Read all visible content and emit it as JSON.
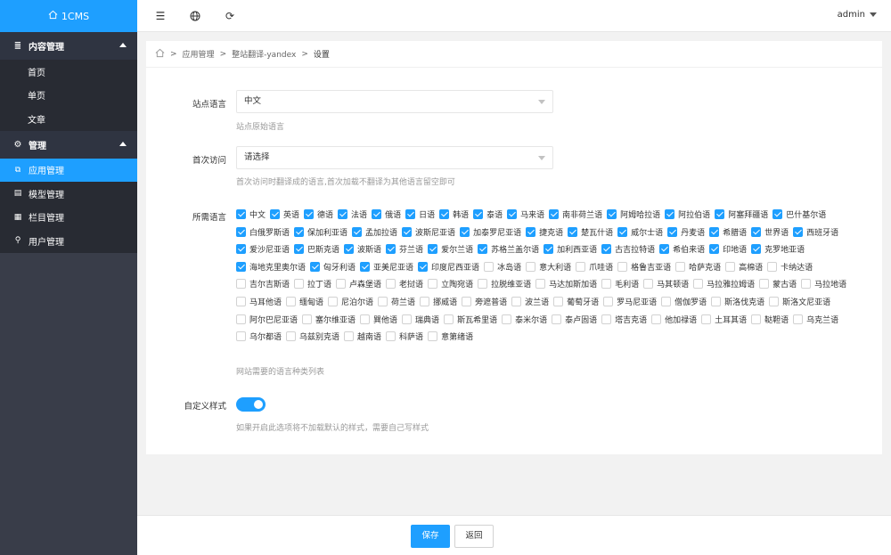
{
  "brand": {
    "icon": "home-icon",
    "name": "1CMS"
  },
  "sidebar": {
    "groups": [
      {
        "label": "内容管理",
        "icon": "list-icon",
        "items": [
          "首页",
          "单页",
          "文章"
        ]
      },
      {
        "label": "管理",
        "icon": "gear-icon",
        "items": [
          {
            "label": "应用管理",
            "icon": "app-icon"
          },
          {
            "label": "模型管理",
            "icon": "model-icon"
          },
          {
            "label": "栏目管理",
            "icon": "column-icon"
          },
          {
            "label": "用户管理",
            "icon": "user-icon"
          }
        ]
      }
    ]
  },
  "topbar": {
    "icons": [
      "menu-toggle-icon",
      "globe-icon",
      "refresh-icon"
    ],
    "user": "admin"
  },
  "breadcrumb": {
    "home_icon": "home-icon",
    "sep": ">",
    "items": [
      "应用管理",
      "整站翻译-yandex",
      "设置"
    ]
  },
  "form": {
    "site_lang": {
      "label": "站点语言",
      "value": "中文",
      "hint": "站点原始语言"
    },
    "first_visit": {
      "label": "首次访问",
      "value": "请选择",
      "hint": "首次访问时翻译成的语言,首次加载不翻译为其他语言留空即可"
    },
    "langs": {
      "label": "所需语言",
      "hint": "网站需要的语言种类列表",
      "options": [
        {
          "name": "中文",
          "checked": true
        },
        {
          "name": "英语",
          "checked": true
        },
        {
          "name": "德语",
          "checked": true
        },
        {
          "name": "法语",
          "checked": true
        },
        {
          "name": "俄语",
          "checked": true
        },
        {
          "name": "日语",
          "checked": true
        },
        {
          "name": "韩语",
          "checked": true
        },
        {
          "name": "泰语",
          "checked": true
        },
        {
          "name": "马来语",
          "checked": true
        },
        {
          "name": "南非荷兰语",
          "checked": true
        },
        {
          "name": "阿姆哈拉语",
          "checked": true
        },
        {
          "name": "阿拉伯语",
          "checked": true
        },
        {
          "name": "阿塞拜疆语",
          "checked": true
        },
        {
          "name": "巴什基尔语",
          "checked": true
        },
        {
          "name": "白俄罗斯语",
          "checked": true
        },
        {
          "name": "保加利亚语",
          "checked": true
        },
        {
          "name": "孟加拉语",
          "checked": true
        },
        {
          "name": "波斯尼亚语",
          "checked": true
        },
        {
          "name": "加泰罗尼亚语",
          "checked": true
        },
        {
          "name": "捷克语",
          "checked": true
        },
        {
          "name": "楚瓦什语",
          "checked": true
        },
        {
          "name": "威尔士语",
          "checked": true
        },
        {
          "name": "丹麦语",
          "checked": true
        },
        {
          "name": "希腊语",
          "checked": true
        },
        {
          "name": "世界语",
          "checked": true
        },
        {
          "name": "西班牙语",
          "checked": true
        },
        {
          "name": "爱沙尼亚语",
          "checked": true
        },
        {
          "name": "巴斯克语",
          "checked": true
        },
        {
          "name": "波斯语",
          "checked": true
        },
        {
          "name": "芬兰语",
          "checked": true
        },
        {
          "name": "爱尔兰语",
          "checked": true
        },
        {
          "name": "苏格兰盖尔语",
          "checked": true
        },
        {
          "name": "加利西亚语",
          "checked": true
        },
        {
          "name": "古吉拉特语",
          "checked": true
        },
        {
          "name": "希伯来语",
          "checked": true
        },
        {
          "name": "印地语",
          "checked": true
        },
        {
          "name": "克罗地亚语",
          "checked": true
        },
        {
          "name": "海地克里奥尔语",
          "checked": true
        },
        {
          "name": "匈牙利语",
          "checked": true
        },
        {
          "name": "亚美尼亚语",
          "checked": true
        },
        {
          "name": "印度尼西亚语",
          "checked": true
        },
        {
          "name": "冰岛语",
          "checked": false
        },
        {
          "name": "意大利语",
          "checked": false
        },
        {
          "name": "爪哇语",
          "checked": false
        },
        {
          "name": "格鲁吉亚语",
          "checked": false
        },
        {
          "name": "哈萨克语",
          "checked": false
        },
        {
          "name": "高棉语",
          "checked": false
        },
        {
          "name": "卡纳达语",
          "checked": false
        },
        {
          "name": "吉尔吉斯语",
          "checked": false
        },
        {
          "name": "拉丁语",
          "checked": false
        },
        {
          "name": "卢森堡语",
          "checked": false
        },
        {
          "name": "老挝语",
          "checked": false
        },
        {
          "name": "立陶宛语",
          "checked": false
        },
        {
          "name": "拉脱维亚语",
          "checked": false
        },
        {
          "name": "马达加斯加语",
          "checked": false
        },
        {
          "name": "毛利语",
          "checked": false
        },
        {
          "name": "马其顿语",
          "checked": false
        },
        {
          "name": "马拉雅拉姆语",
          "checked": false
        },
        {
          "name": "蒙古语",
          "checked": false
        },
        {
          "name": "马拉地语",
          "checked": false
        },
        {
          "name": "马耳他语",
          "checked": false
        },
        {
          "name": "缅甸语",
          "checked": false
        },
        {
          "name": "尼泊尔语",
          "checked": false
        },
        {
          "name": "荷兰语",
          "checked": false
        },
        {
          "name": "挪威语",
          "checked": false
        },
        {
          "name": "旁遮普语",
          "checked": false
        },
        {
          "name": "波兰语",
          "checked": false
        },
        {
          "name": "葡萄牙语",
          "checked": false
        },
        {
          "name": "罗马尼亚语",
          "checked": false
        },
        {
          "name": "僧伽罗语",
          "checked": false
        },
        {
          "name": "斯洛伐克语",
          "checked": false
        },
        {
          "name": "斯洛文尼亚语",
          "checked": false
        },
        {
          "name": "阿尔巴尼亚语",
          "checked": false
        },
        {
          "name": "塞尔维亚语",
          "checked": false
        },
        {
          "name": "巽他语",
          "checked": false
        },
        {
          "name": "瑞典语",
          "checked": false
        },
        {
          "name": "斯瓦希里语",
          "checked": false
        },
        {
          "name": "泰米尔语",
          "checked": false
        },
        {
          "name": "泰卢固语",
          "checked": false
        },
        {
          "name": "塔吉克语",
          "checked": false
        },
        {
          "name": "他加禄语",
          "checked": false
        },
        {
          "name": "土耳其语",
          "checked": false
        },
        {
          "name": "鞑靼语",
          "checked": false
        },
        {
          "name": "乌克兰语",
          "checked": false
        },
        {
          "name": "乌尔都语",
          "checked": false
        },
        {
          "name": "乌兹别克语",
          "checked": false
        },
        {
          "name": "越南语",
          "checked": false
        },
        {
          "name": "科萨语",
          "checked": false
        },
        {
          "name": "意第绪语",
          "checked": false
        }
      ]
    },
    "custom_style": {
      "label": "自定义样式",
      "on": true,
      "hint": "如果开启此选项将不加载默认的样式，需要自己写样式"
    }
  },
  "footer": {
    "save": "保存",
    "back": "返回"
  }
}
